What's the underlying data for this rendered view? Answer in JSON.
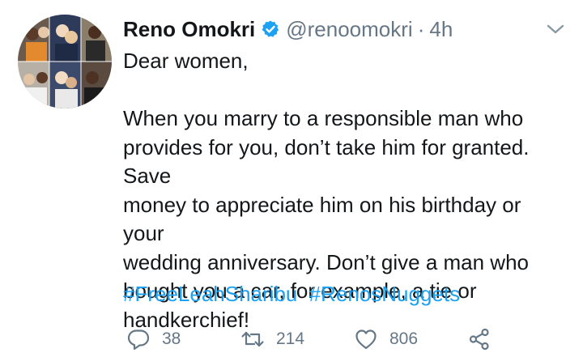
{
  "tweet": {
    "author_name": "Reno Omokri",
    "verified": true,
    "handle": "@renoomokri",
    "separator": "·",
    "time": "4h",
    "body_lines": [
      "Dear women,",
      "",
      "When you marry to a responsible man who",
      "provides for you, don’t take him for granted. Save",
      "money to appreciate him on his birthday or your",
      "wedding anniversary. Don’t give a man who",
      "bought you a car, for example, a tie or",
      "handkerchief!"
    ],
    "hashtags": [
      "#FreeLeahSharibu",
      "#RenosNuggets"
    ],
    "stats": {
      "replies": "38",
      "retweets": "214",
      "likes": "806"
    }
  },
  "icons": {
    "caret": "chevron-down-icon",
    "verified": "verified-badge-icon",
    "reply": "reply-icon",
    "retweet": "retweet-icon",
    "like": "heart-icon",
    "share": "share-icon"
  },
  "colors": {
    "link": "#1da1f2",
    "muted": "#657786",
    "text": "#14171a"
  }
}
